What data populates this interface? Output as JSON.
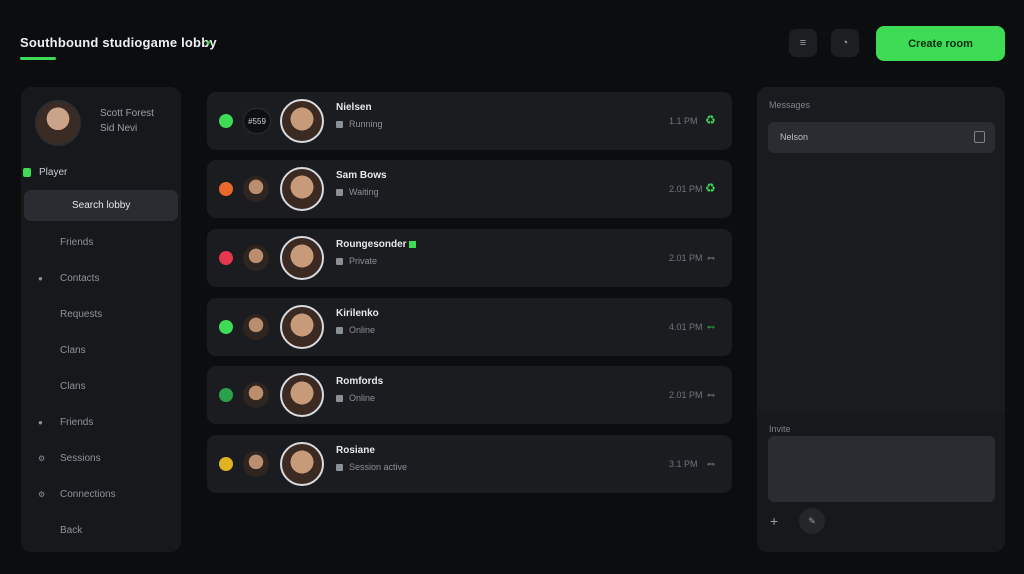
{
  "header": {
    "title": "Southbound studiogame lobby",
    "menu_icon": "≡",
    "profile_icon": "◔",
    "primary_button": "Create room"
  },
  "sidebar": {
    "profile_name": "Scott Forest",
    "profile_sub": "Sid Nevi",
    "status_label": "Player",
    "items": [
      {
        "label": "Search lobby",
        "icon": "",
        "active": true
      },
      {
        "label": "Friends",
        "icon": ""
      },
      {
        "label": "Contacts",
        "icon": "●"
      },
      {
        "label": "Requests",
        "icon": ""
      },
      {
        "label": "Clans",
        "icon": ""
      },
      {
        "label": "Clans",
        "icon": ""
      },
      {
        "label": "Friends",
        "icon": "●"
      },
      {
        "label": "Sessions",
        "icon": "⚙"
      },
      {
        "label": "Connections",
        "icon": "⚙"
      },
      {
        "label": "Back",
        "icon": ""
      }
    ]
  },
  "chats": [
    {
      "name": "Nielsen",
      "message": "Running",
      "time": "1.1 PM",
      "status_color": "#3ddc54",
      "mini_text": "#559",
      "action_icon": "♻",
      "action_color": "#3ddc54",
      "badge": false
    },
    {
      "name": "Sam Bows",
      "message": "Waiting",
      "time": "2.01 PM",
      "status_color": "#e8692b",
      "mini_text": "",
      "action_icon": "♻",
      "action_color": "#3ddc54",
      "badge": false
    },
    {
      "name": "Roungesonder",
      "message": "Private",
      "time": "2.01 PM",
      "status_color": "#e5384f",
      "mini_text": "",
      "action_icon": "⇔",
      "action_color": "#9aa0a8",
      "badge": true
    },
    {
      "name": "Kirilenko",
      "message": "Online",
      "time": "4.01 PM",
      "status_color": "#3ddc54",
      "mini_text": "",
      "action_icon": "⇔",
      "action_color": "#3ddc54",
      "badge": false
    },
    {
      "name": "Romfords",
      "message": "Online",
      "time": "2.01 PM",
      "status_color": "#2aa14a",
      "mini_text": "",
      "action_icon": "⇔",
      "action_color": "#9aa0a8",
      "badge": false
    },
    {
      "name": "Rosiane",
      "message": "Session active",
      "time": "3.1 PM",
      "status_color": "#e0b321",
      "mini_text": "",
      "action_icon": "⇔",
      "action_color": "#9aa0a8",
      "badge": false
    }
  ],
  "right_panel": {
    "label": "Messages",
    "field_label": "Nelson",
    "field_icon": "▯",
    "label2": "Invite",
    "textarea_placeholder": "",
    "add_icon": "+",
    "attach_icon": "✎"
  },
  "colors": {
    "accent": "#3ddc54",
    "background": "#0c0d0f"
  }
}
